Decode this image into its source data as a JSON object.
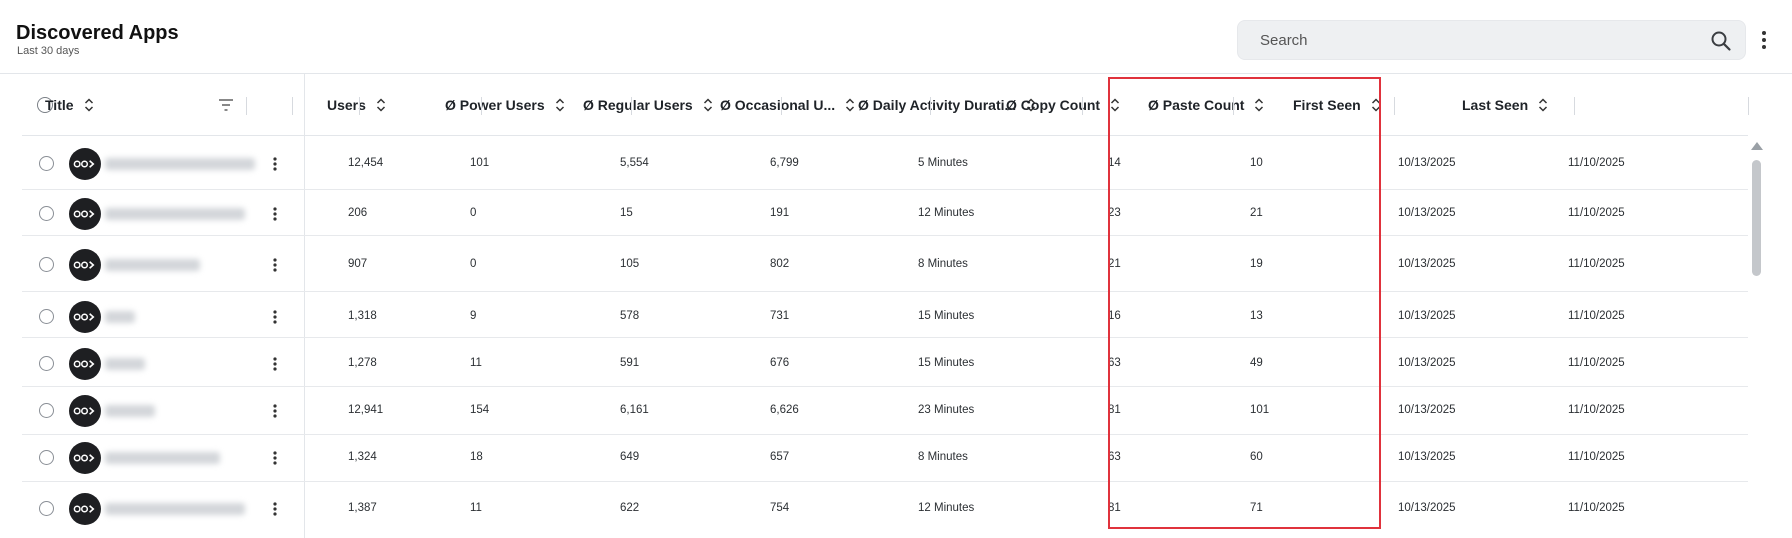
{
  "header": {
    "title": "Discovered Apps",
    "subtitle": "Last 30 days",
    "search_placeholder": "Search"
  },
  "table": {
    "columns": [
      {
        "key": "title",
        "label": "Title"
      },
      {
        "key": "users",
        "label": "Users"
      },
      {
        "key": "power_users",
        "label": "Ø Power Users"
      },
      {
        "key": "regular_users",
        "label": "Ø Regular Users"
      },
      {
        "key": "occasional_users",
        "label": "Ø Occasional U..."
      },
      {
        "key": "daily_activity",
        "label": "Ø Daily Activity Durati..."
      },
      {
        "key": "copy_count",
        "label": "Ø Copy Count"
      },
      {
        "key": "paste_count",
        "label": "Ø Paste Count"
      },
      {
        "key": "first_seen",
        "label": "First Seen"
      },
      {
        "key": "last_seen",
        "label": "Last Seen"
      }
    ],
    "rows": [
      {
        "users": "12,454",
        "power_users": "101",
        "regular_users": "5,554",
        "occasional_users": "6,799",
        "daily_activity": "5 Minutes",
        "copy_count": "14",
        "paste_count": "10",
        "first_seen": "10/13/2025",
        "last_seen": "11/10/2025"
      },
      {
        "users": "206",
        "power_users": "0",
        "regular_users": "15",
        "occasional_users": "191",
        "daily_activity": "12 Minutes",
        "copy_count": "23",
        "paste_count": "21",
        "first_seen": "10/13/2025",
        "last_seen": "11/10/2025"
      },
      {
        "users": "907",
        "power_users": "0",
        "regular_users": "105",
        "occasional_users": "802",
        "daily_activity": "8 Minutes",
        "copy_count": "21",
        "paste_count": "19",
        "first_seen": "10/13/2025",
        "last_seen": "11/10/2025"
      },
      {
        "users": "1,318",
        "power_users": "9",
        "regular_users": "578",
        "occasional_users": "731",
        "daily_activity": "15 Minutes",
        "copy_count": "16",
        "paste_count": "13",
        "first_seen": "10/13/2025",
        "last_seen": "11/10/2025"
      },
      {
        "users": "1,278",
        "power_users": "11",
        "regular_users": "591",
        "occasional_users": "676",
        "daily_activity": "15 Minutes",
        "copy_count": "63",
        "paste_count": "49",
        "first_seen": "10/13/2025",
        "last_seen": "11/10/2025"
      },
      {
        "users": "12,941",
        "power_users": "154",
        "regular_users": "6,161",
        "occasional_users": "6,626",
        "daily_activity": "23 Minutes",
        "copy_count": "81",
        "paste_count": "101",
        "first_seen": "10/13/2025",
        "last_seen": "11/10/2025"
      },
      {
        "users": "1,324",
        "power_users": "18",
        "regular_users": "649",
        "occasional_users": "657",
        "daily_activity": "8 Minutes",
        "copy_count": "63",
        "paste_count": "60",
        "first_seen": "10/13/2025",
        "last_seen": "11/10/2025"
      },
      {
        "users": "1,387",
        "power_users": "11",
        "regular_users": "622",
        "occasional_users": "754",
        "daily_activity": "12 Minutes",
        "copy_count": "81",
        "paste_count": "71",
        "first_seen": "10/13/2025",
        "last_seen": "11/10/2025"
      }
    ]
  },
  "icons": {
    "search": "search-icon",
    "more": "kebab-menu-icon",
    "sort": "sort-updown-icon",
    "filter": "filter-icon",
    "app_logo": "app-logo-icon"
  },
  "colors": {
    "highlight": "#e0323c",
    "app_logo_bg": "#1e1f22"
  }
}
